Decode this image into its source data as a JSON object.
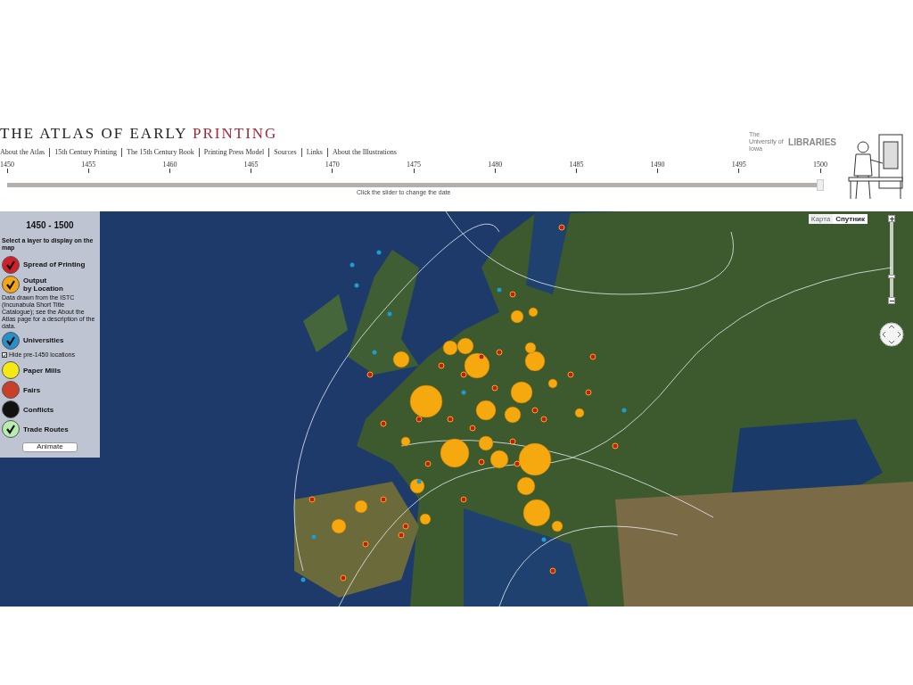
{
  "header": {
    "title": "THE ATLAS OF EARLY",
    "title_accent": "PRINTING",
    "logo_small": "The University of Iowa",
    "logo": "LIBRARIES"
  },
  "nav": [
    "About the Atlas",
    "15th Century Printing",
    "The 15th Century Book",
    "Printing Press Model",
    "Sources",
    "Links",
    "About the Illustrations"
  ],
  "timeline": {
    "ticks": [
      "1450",
      "1455",
      "1460",
      "1465",
      "1470",
      "1475",
      "1480",
      "1485",
      "1490",
      "1495",
      "1500"
    ],
    "level": 1,
    "hint": "Click the slider to change the date"
  },
  "panel": {
    "range": "1450 - 1500",
    "prompt": "Select a layer to display on the map",
    "layers": [
      {
        "kind": "layer",
        "label": "Spread of Printing",
        "color": "#d0202a",
        "checked": true
      },
      {
        "kind": "layer",
        "label": "Output\nby Location",
        "color": "#f2a516",
        "checked": true
      },
      {
        "kind": "note",
        "text": "Data drawn from the ISTC (Incunabula Short Title Catalogue); see the About the Atlas page for a description of the data."
      },
      {
        "kind": "layer",
        "label": "Universities",
        "color": "#2a8fc8",
        "checked": true
      },
      {
        "kind": "checkbox",
        "label": "Hide pre-1450 locations",
        "checked": true
      },
      {
        "kind": "layer",
        "label": "Paper Mills",
        "color": "#f5e914",
        "checked": false
      },
      {
        "kind": "layer",
        "label": "Fairs",
        "color": "#c8402a",
        "checked": false
      },
      {
        "kind": "layer",
        "label": "Conflicts",
        "color": "#111111",
        "checked": false
      },
      {
        "kind": "layer",
        "label": "Trade Routes",
        "color": "#b8ecb0",
        "checked": true
      }
    ],
    "button": "Animate"
  },
  "map": {
    "types": [
      {
        "label": "Карта",
        "selected": false
      },
      {
        "label": "Спутник",
        "selected": true
      }
    ],
    "zoom": {
      "level": 0.3
    }
  }
}
